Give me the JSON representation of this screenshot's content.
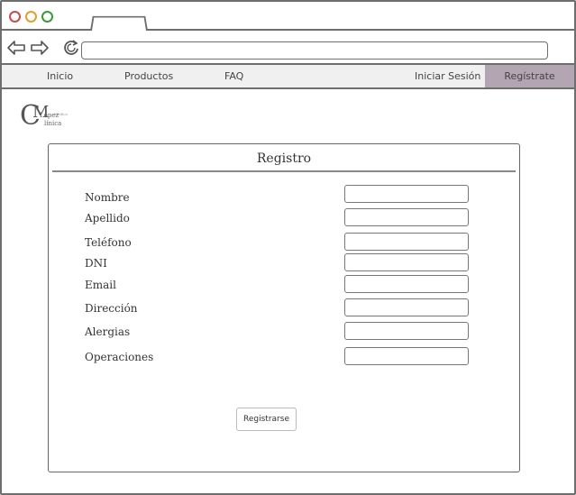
{
  "window": {
    "controls": [
      "close",
      "minimize",
      "maximize"
    ]
  },
  "navigation": {
    "back_icon": "arrow-left-icon",
    "forward_icon": "arrow-right-icon",
    "reload_icon": "reload-icon",
    "url_value": ""
  },
  "menu": {
    "items": [
      {
        "label": "Inicio"
      },
      {
        "label": "Productos"
      },
      {
        "label": "FAQ"
      },
      {
        "label": "Iniciar Sesión"
      },
      {
        "label": "Regístrate",
        "active": true
      }
    ],
    "active_color": "#b3a6b2"
  },
  "logo": {
    "letters_big": "C",
    "letter_m": "M",
    "line1": "Lopez",
    "line2": "línica",
    "tiny": "Médica"
  },
  "form": {
    "title": "Registro",
    "fields": [
      {
        "label": "Nombre",
        "value": ""
      },
      {
        "label": "Apellido",
        "value": ""
      },
      {
        "label": "Teléfono",
        "value": ""
      },
      {
        "label": "DNI",
        "value": ""
      },
      {
        "label": "Email",
        "value": ""
      },
      {
        "label": "Dirección",
        "value": ""
      },
      {
        "label": "Alergias",
        "value": ""
      },
      {
        "label": "Operaciones",
        "value": ""
      }
    ],
    "submit_label": "Registrarse"
  }
}
